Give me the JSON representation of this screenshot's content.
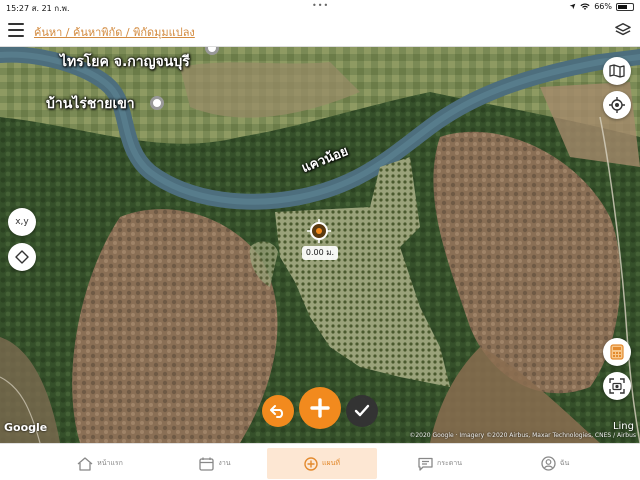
{
  "status_bar": {
    "time_date": "15:27  ส. 21 ก.พ.",
    "dots": "•••",
    "battery_text": "66%",
    "battery_level": 0.66
  },
  "header": {
    "menu_icon": "hamburger-icon",
    "breadcrumb": "ค้นหา / ค้นหาพิกัด / พิกัดมุมแปลง",
    "layers_icon": "layers-icon",
    "accent_color": "#d38a3e"
  },
  "map": {
    "labels": {
      "main_place": "ไทรโยค จ.กาญจนบุรี",
      "village": "บ้านไร่ชายเขา",
      "river": "แควน้อย"
    },
    "distance_value": "0.00 ม.",
    "left_controls": {
      "coords_label": "x,y",
      "draw_icon": "diamond-icon"
    },
    "right_controls": {
      "map_type_icon": "map-icon",
      "locate_icon": "gps-target-icon",
      "calculator_icon": "calculator-icon",
      "screenshot_icon": "camera-frame-icon"
    },
    "actions": {
      "undo_icon": "undo-icon",
      "add_icon": "plus-icon",
      "confirm_icon": "checkmark-icon"
    },
    "google_logo": "Google",
    "scale_label": "Ling",
    "attribution": "©2020 Google · Imagery ©2020 Airbus, Maxar Technologies, CNES / Airbus"
  },
  "tabs": [
    {
      "label": "หน้าแรก",
      "icon": "home-icon",
      "active": false
    },
    {
      "label": "งาน",
      "icon": "calendar-icon",
      "active": false
    },
    {
      "label": "แผนที่",
      "icon": "plus-circle-icon",
      "active": true
    },
    {
      "label": "กระดาน",
      "icon": "message-board-icon",
      "active": false
    },
    {
      "label": "ฉัน",
      "icon": "user-icon",
      "active": false
    }
  ],
  "colors": {
    "accent": "#f28a1e",
    "active_tab_bg": "#fde7d3",
    "active_tab_text": "#e38a2e",
    "river": "#4d6e7d"
  }
}
